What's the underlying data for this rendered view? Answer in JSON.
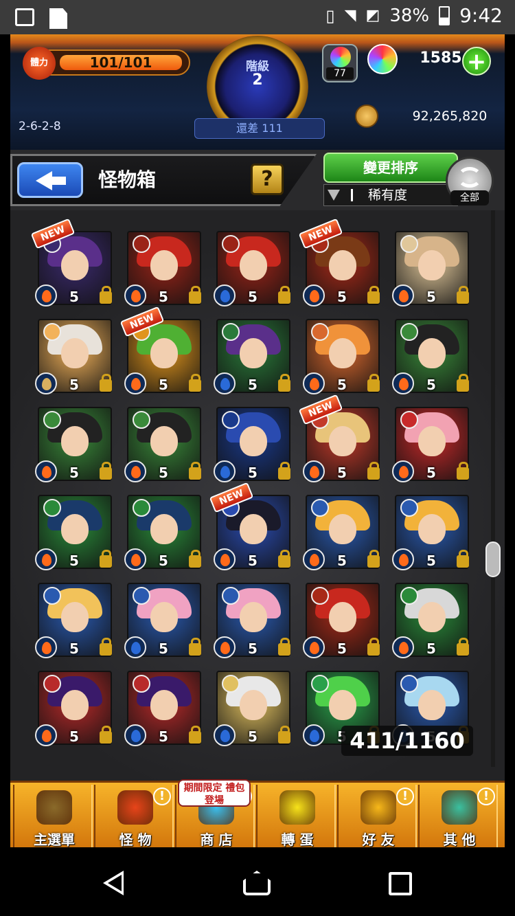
{
  "statusbar": {
    "battery": "38%",
    "time": "9:42"
  },
  "header": {
    "stamina_label": "體力",
    "stamina": "101/101",
    "rank_label": "階級",
    "rank": "2",
    "remaining": "還差 111",
    "crystal_box_count": "77",
    "orb_count": "1585",
    "gold": "92,265,820",
    "stage": "2-6-2-8"
  },
  "titlebar": {
    "title": "怪物箱",
    "help": "?",
    "sort_button": "變更排序",
    "sort_mode": "稀有度",
    "all_label": "全部"
  },
  "grid": {
    "level": "5",
    "counter": "411/1160",
    "new_tag": "NEW",
    "rows": [
      [
        {
          "elem": "fire",
          "new": true,
          "hair": "#5a2f8a",
          "bg": "#3b2a6e"
        },
        {
          "elem": "fire",
          "new": false,
          "hair": "#c8281e",
          "bg": "#9b2418"
        },
        {
          "elem": "water",
          "new": false,
          "hair": "#c8281e",
          "bg": "#9b2418"
        },
        {
          "elem": "fire",
          "new": true,
          "hair": "#7a3a16",
          "bg": "#a82a18"
        },
        {
          "elem": "fire",
          "new": false,
          "hair": "#d7b48a",
          "bg": "#e0c79a"
        }
      ],
      [
        {
          "elem": "none",
          "new": false,
          "hair": "#e8e2da",
          "bg": "#f2b25a"
        },
        {
          "elem": "fire",
          "new": true,
          "hair": "#4fb033",
          "bg": "#e0951d"
        },
        {
          "elem": "water",
          "new": false,
          "hair": "#5a2f8a",
          "bg": "#2a7a3a"
        },
        {
          "elem": "fire",
          "new": false,
          "hair": "#f0923a",
          "bg": "#d8682e"
        },
        {
          "elem": "fire",
          "new": false,
          "hair": "#222",
          "bg": "#3a8a3a"
        }
      ],
      [
        {
          "elem": "fire",
          "new": false,
          "hair": "#222",
          "bg": "#3a8a3a"
        },
        {
          "elem": "fire",
          "new": false,
          "hair": "#222",
          "bg": "#3a8a3a"
        },
        {
          "elem": "water",
          "new": false,
          "hair": "#2a4bb0",
          "bg": "#1a3a8c"
        },
        {
          "elem": "fire",
          "new": true,
          "hair": "#e8c47a",
          "bg": "#c33a2a"
        },
        {
          "elem": "fire",
          "new": false,
          "hair": "#f2a2b2",
          "bg": "#c82a2a"
        }
      ],
      [
        {
          "elem": "fire",
          "new": false,
          "hair": "#1a3a6a",
          "bg": "#2a8a3a"
        },
        {
          "elem": "fire",
          "new": false,
          "hair": "#1a3a6a",
          "bg": "#2a8a3a"
        },
        {
          "elem": "fire",
          "new": true,
          "hair": "#1a1a2a",
          "bg": "#2a4bb0"
        },
        {
          "elem": "fire",
          "new": false,
          "hair": "#f2b23a",
          "bg": "#2a5ab0"
        },
        {
          "elem": "fire",
          "new": false,
          "hair": "#f2b23a",
          "bg": "#2a5ab0"
        }
      ],
      [
        {
          "elem": "fire",
          "new": false,
          "hair": "#f2c25a",
          "bg": "#2a5ab0"
        },
        {
          "elem": "water",
          "new": false,
          "hair": "#f0a2c2",
          "bg": "#2a5ab0"
        },
        {
          "elem": "fire",
          "new": false,
          "hair": "#f0a2c2",
          "bg": "#2a5ab0"
        },
        {
          "elem": "fire",
          "new": false,
          "hair": "#c8281e",
          "bg": "#a82a18"
        },
        {
          "elem": "fire",
          "new": false,
          "hair": "#d8d8d8",
          "bg": "#2a8a3a"
        }
      ],
      [
        {
          "elem": "fire",
          "new": false,
          "hair": "#3a1a6a",
          "bg": "#b82a2a"
        },
        {
          "elem": "water",
          "new": false,
          "hair": "#3a1a6a",
          "bg": "#b82a2a"
        },
        {
          "elem": "water",
          "new": false,
          "hair": "#e8e8e8",
          "bg": "#e0c060"
        },
        {
          "elem": "water",
          "new": false,
          "hair": "#4fd04a",
          "bg": "#2aa04a"
        },
        {
          "elem": "water",
          "new": false,
          "hair": "#a8d8f0",
          "bg": "#2a5ab0"
        }
      ]
    ]
  },
  "bottomnav": {
    "items": [
      {
        "label": "主選單",
        "color": "#8a6a2a"
      },
      {
        "label": "怪 物",
        "color": "#e8441a"
      },
      {
        "label": "商 店",
        "color": "#3ac0f0"
      },
      {
        "label": "轉 蛋",
        "color": "#f7e31a"
      },
      {
        "label": "好 友",
        "color": "#f7b81a"
      },
      {
        "label": "其 他",
        "color": "#3ac0a0"
      }
    ],
    "limited_text": "期間限定 禮包登場"
  }
}
